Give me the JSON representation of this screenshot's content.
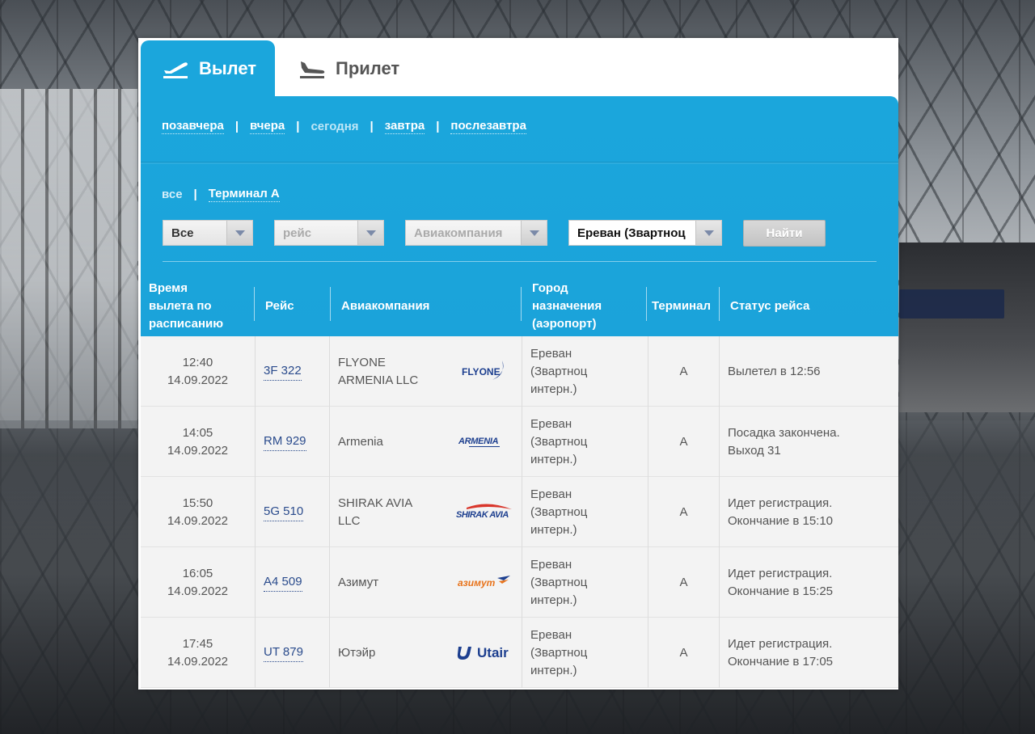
{
  "tabs": [
    {
      "label": "Вылет",
      "icon": "plane-takeoff-icon",
      "active": true
    },
    {
      "label": "Прилет",
      "icon": "plane-landing-icon",
      "active": false
    }
  ],
  "days": [
    "позавчера",
    "вчера",
    "сегодня",
    "завтра",
    "послезавтра"
  ],
  "days_active": "сегодня",
  "terminals": {
    "all": "все",
    "terminal_a": "Терминал A"
  },
  "filters": {
    "status_value": "Все",
    "flight_placeholder": "рейс",
    "airline_placeholder": "Авиакомпания",
    "city_value": "Ереван (Звартноц",
    "find_button": "Найти"
  },
  "columns": {
    "time": [
      "Время",
      "вылета по",
      "расписанию"
    ],
    "flight": "Рейс",
    "airline": "Авиакомпания",
    "city": [
      "Город",
      "назначения",
      "(аэропорт)"
    ],
    "terminal": "Терминал",
    "status": "Статус рейса"
  },
  "flights": [
    {
      "time": "12:40",
      "date": "14.09.2022",
      "flight": "3F 322",
      "airline": [
        "FLYONE",
        "ARMENIA LLC"
      ],
      "logo": "FLYONE",
      "city": [
        "Ереван",
        "(Звартноц",
        "интерн.)"
      ],
      "terminal": "A",
      "status": [
        "Вылетел в 12:56"
      ]
    },
    {
      "time": "14:05",
      "date": "14.09.2022",
      "flight": "RM 929",
      "airline": [
        "Armenia"
      ],
      "logo": "ARMENIA",
      "city": [
        "Ереван",
        "(Звартноц",
        "интерн.)"
      ],
      "terminal": "A",
      "status": [
        "Посадка закончена.",
        "Выход 31"
      ]
    },
    {
      "time": "15:50",
      "date": "14.09.2022",
      "flight": "5G 510",
      "airline": [
        "SHIRAK AVIA",
        "LLC"
      ],
      "logo": "SHIRAK AVIA",
      "city": [
        "Ереван",
        "(Звартноц",
        "интерн.)"
      ],
      "terminal": "A",
      "status": [
        "Идет регистрация.",
        "Окончание в 15:10"
      ]
    },
    {
      "time": "16:05",
      "date": "14.09.2022",
      "flight": "A4 509",
      "airline": [
        "Азимут"
      ],
      "logo": "азимут",
      "city": [
        "Ереван",
        "(Звартноц",
        "интерн.)"
      ],
      "terminal": "A",
      "status": [
        "Идет регистрация.",
        "Окончание в 15:25"
      ]
    },
    {
      "time": "17:45",
      "date": "14.09.2022",
      "flight": "UT 879",
      "airline": [
        "Ютэйр"
      ],
      "logo": "Utair",
      "city": [
        "Ереван",
        "(Звартноц",
        "интерн.)"
      ],
      "terminal": "A",
      "status": [
        "Идет регистрация.",
        "Окончание в 17:05"
      ]
    }
  ],
  "colors": {
    "accent": "#1ba6dc",
    "link": "#2a4b8c",
    "row_bg": "#f3f3f3"
  }
}
